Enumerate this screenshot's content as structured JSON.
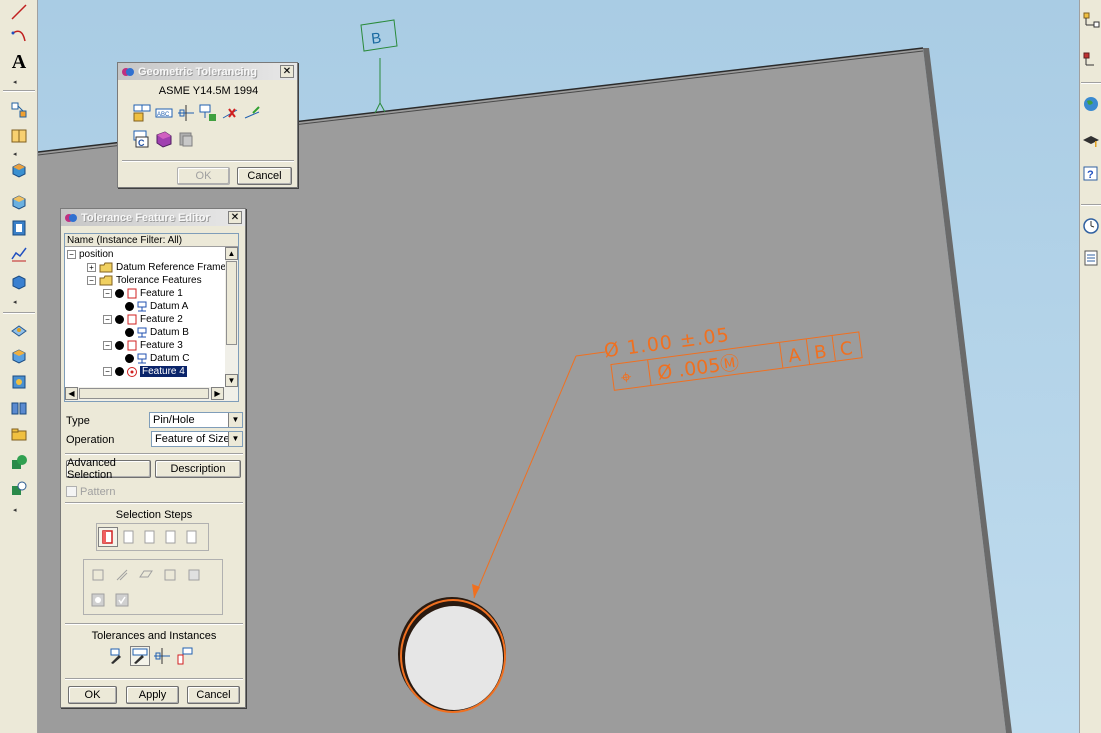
{
  "scene": {
    "datum_label": "B",
    "size_tolerance": "Ø 1.00 ±.05",
    "fcf": {
      "symbol": "⌖",
      "tolerance": "Ø .005Ⓜ",
      "datums": [
        "A",
        "B",
        "C"
      ]
    },
    "colors": {
      "annotation": "#f07020",
      "datum": "#2a8a3a",
      "part": "#9c9c9c"
    }
  },
  "left_toolbar": {
    "text_tool_label": "A",
    "icons": [
      "line-icon",
      "arc-icon",
      "text-icon",
      "dimension-icon",
      "view-icon",
      "cube-icon",
      "cube-outline-icon",
      "frame-icon",
      "chart-icon",
      "box-icon",
      "layer-icon",
      "stack-icon",
      "part-icon",
      "book-icon",
      "folder-icon",
      "shape-icon",
      "probe-icon"
    ]
  },
  "right_toolbar": {
    "icons": [
      "tree-icon",
      "tree-text-icon",
      "earth-icon",
      "grad-cap-icon",
      "help-icon",
      "clock-icon",
      "list-icon"
    ]
  },
  "geo_dialog": {
    "title": "Geometric Tolerancing",
    "standard": "ASME Y14.5M 1994",
    "ok": "OK",
    "cancel": "Cancel",
    "icons": [
      "feature-control-icon",
      "abc-label-icon",
      "datum-target-icon",
      "datum-feature-icon",
      "remove-tolerance-icon",
      "edit-tolerance-icon",
      "report-icon",
      "book-icon",
      "database-icon"
    ]
  },
  "tfe_dialog": {
    "title": "Tolerance Feature Editor",
    "tree_header": "Name (Instance Filter: All)",
    "tree": [
      {
        "label": "position",
        "level": 0,
        "pm": "−",
        "kind": "root"
      },
      {
        "label": "Datum Reference Frames",
        "level": 1,
        "pm": "+",
        "kind": "folder"
      },
      {
        "label": "Tolerance Features",
        "level": 1,
        "pm": "−",
        "kind": "folder"
      },
      {
        "label": "Feature 1",
        "level": 2,
        "pm": "−",
        "kind": "feature"
      },
      {
        "label": "Datum A",
        "level": 3,
        "pm": "",
        "kind": "datum"
      },
      {
        "label": "Feature 2",
        "level": 2,
        "pm": "−",
        "kind": "feature"
      },
      {
        "label": "Datum B",
        "level": 3,
        "pm": "",
        "kind": "datum"
      },
      {
        "label": "Feature 3",
        "level": 2,
        "pm": "−",
        "kind": "feature"
      },
      {
        "label": "Datum C",
        "level": 3,
        "pm": "",
        "kind": "datum"
      },
      {
        "label": "Feature 4",
        "level": 2,
        "pm": "−",
        "kind": "feature-selected"
      }
    ],
    "type_label": "Type",
    "type_value": "Pin/Hole",
    "operation_label": "Operation",
    "operation_value": "Feature of Size",
    "advanced_selection": "Advanced Selection",
    "description": "Description",
    "pattern": "Pattern",
    "selection_steps": "Selection Steps",
    "tolerances_and_instances": "Tolerances and Instances",
    "ok": "OK",
    "apply": "Apply",
    "cancel": "Cancel"
  }
}
